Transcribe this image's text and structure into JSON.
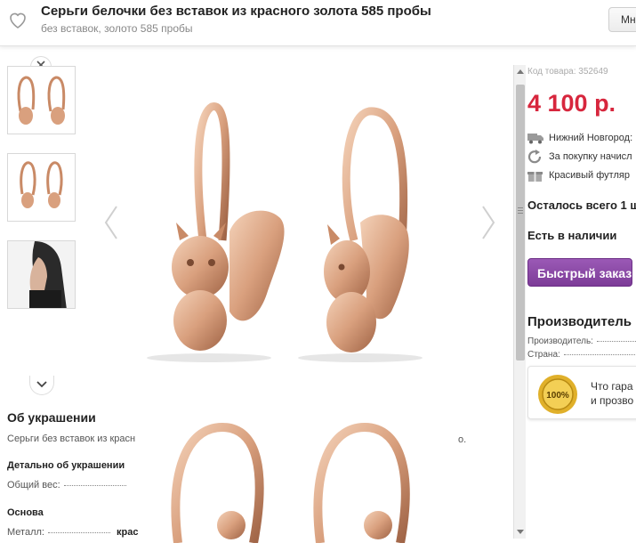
{
  "header": {
    "title": "Серьги белочки без вставок из красного золота 585 пробы",
    "subtitle": "без вставок, золото 585 пробы",
    "more_button": "Мн"
  },
  "gallery": {
    "thumbnails": [
      "earrings-front-view",
      "earrings-side-view",
      "model-wearing"
    ]
  },
  "about": {
    "heading": "Об украшении",
    "description": "Серьги без вставок из красн",
    "description_tail": "о.",
    "details_heading": "Детально об украшении",
    "weight_label": "Общий вес:",
    "base_heading": "Основа",
    "metal_label": "Металл:",
    "metal_value": "крас"
  },
  "product": {
    "code": "Код товара: 352649",
    "price": "4 100 р.",
    "delivery": "Нижний Новгород:",
    "bonus": "За покупку начисл",
    "gift": "Красивый футляр",
    "remaining": "Осталось всего 1 ш",
    "availability": "Есть в наличии",
    "quick_order": "Быстрый заказ"
  },
  "manufacturer": {
    "heading": "Производитель и",
    "maker_label": "Производитель:",
    "country_label": "Страна:"
  },
  "guarantee": {
    "badge_text": "100%",
    "line1": "Что гара",
    "line2": "и прозво"
  },
  "colors": {
    "price": "#d7263d",
    "button": "#8e44ad",
    "gold": "#d9a07e"
  }
}
